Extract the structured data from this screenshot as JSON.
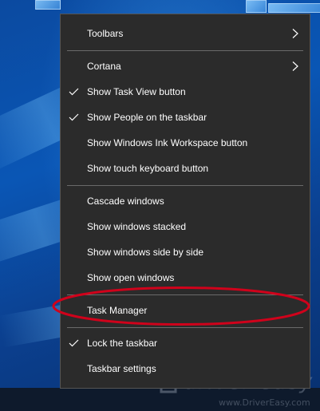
{
  "colors": {
    "menu_background": "#2b2b2b",
    "menu_text": "#ffffff",
    "separator": "#6a6a6a",
    "highlight_ellipse": "#d0021b"
  },
  "context_menu": {
    "items": [
      {
        "label": "Toolbars",
        "checked": false,
        "submenu": true
      },
      {
        "label": "Cortana",
        "checked": false,
        "submenu": true
      },
      {
        "label": "Show Task View button",
        "checked": true,
        "submenu": false
      },
      {
        "label": "Show People on the taskbar",
        "checked": true,
        "submenu": false
      },
      {
        "label": "Show Windows Ink Workspace button",
        "checked": false,
        "submenu": false
      },
      {
        "label": "Show touch keyboard button",
        "checked": false,
        "submenu": false
      },
      {
        "label": "Cascade windows",
        "checked": false,
        "submenu": false
      },
      {
        "label": "Show windows stacked",
        "checked": false,
        "submenu": false
      },
      {
        "label": "Show windows side by side",
        "checked": false,
        "submenu": false
      },
      {
        "label": "Show open windows",
        "checked": false,
        "submenu": false
      },
      {
        "label": "Task Manager",
        "checked": false,
        "submenu": false,
        "highlighted": true
      },
      {
        "label": "Lock the taskbar",
        "checked": true,
        "submenu": false
      },
      {
        "label": "Taskbar settings",
        "checked": false,
        "submenu": false
      }
    ]
  },
  "watermark": {
    "name": "driver easy",
    "url": "www.DriverEasy.com",
    "icon": "drivereasy-logo-icon"
  },
  "icons": {
    "check": "checkmark-icon",
    "submenu": "chevron-right-icon"
  }
}
